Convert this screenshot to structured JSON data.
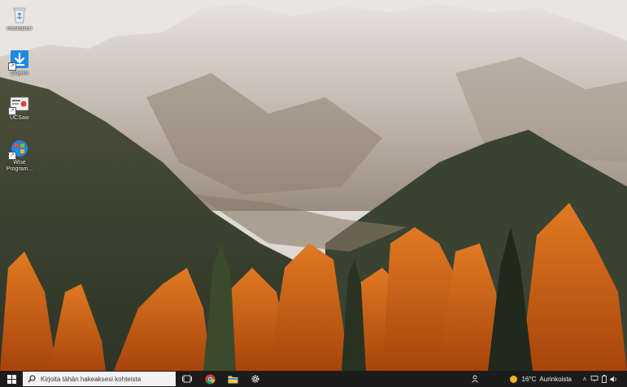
{
  "desktop": {
    "icons": [
      {
        "name": "recycle-bin",
        "label": "Roskakori",
        "shortcut": false
      },
      {
        "name": "downloads",
        "label": "Ohjelm",
        "shortcut": true
      },
      {
        "name": "ucsaw",
        "label": "UCSaw",
        "shortcut": true
      },
      {
        "name": "wise-program-uninstaller",
        "label": "Wise Program...",
        "shortcut": true
      }
    ]
  },
  "taskbar": {
    "search_placeholder": "Kirjoita tähän hakeaksesi kohteista",
    "weather": {
      "temperature": "16°C",
      "condition": "Aurinkoista"
    }
  },
  "colors": {
    "taskbar_bg": "#1c1c1c",
    "search_bg": "#f2f2f2",
    "start_icon": "#ffffff",
    "weather_sun": "#f5b41a",
    "download_icon": "#1e88e5"
  }
}
